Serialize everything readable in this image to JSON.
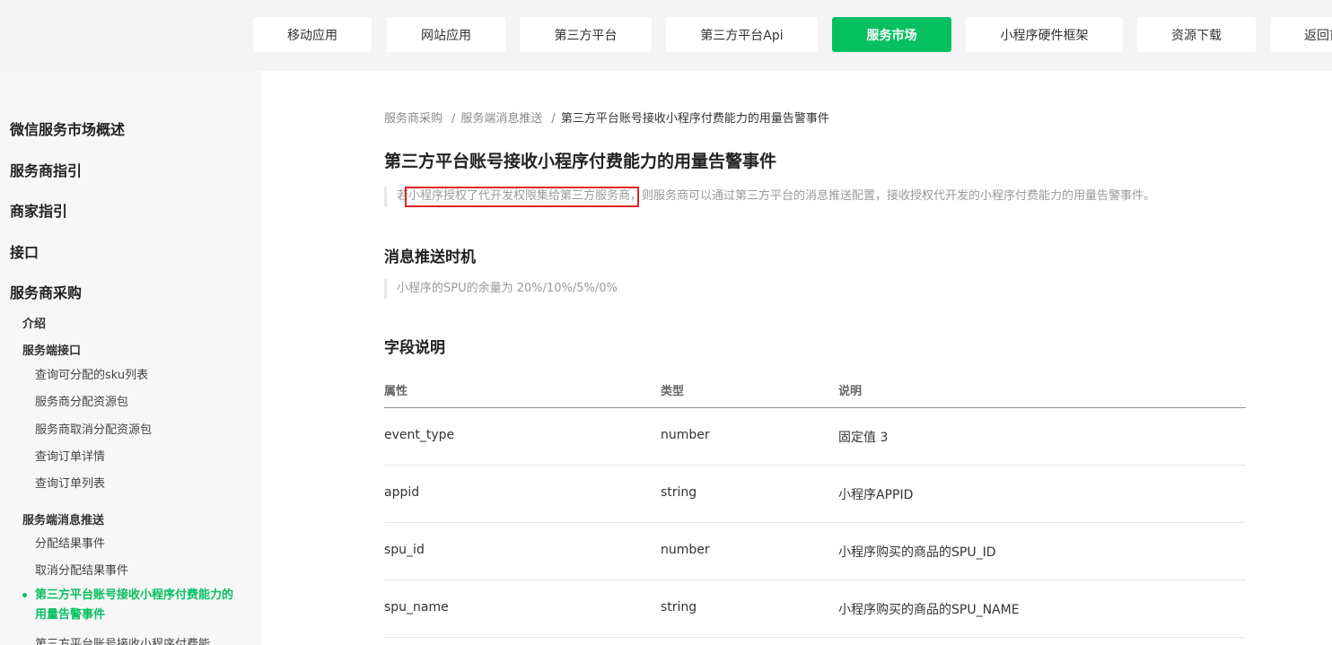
{
  "top_nav": {
    "items": [
      {
        "label": "移动应用"
      },
      {
        "label": "网站应用"
      },
      {
        "label": "第三方平台"
      },
      {
        "label": "第三方平台Api"
      },
      {
        "label": "服务市场",
        "active": true
      },
      {
        "label": "小程序硬件框架"
      },
      {
        "label": "资源下载"
      },
      {
        "label": "返回首"
      }
    ],
    "active_color": "#07c160"
  },
  "sidebar": {
    "level1": [
      {
        "label": "微信服务市场概述"
      },
      {
        "label": "服务商指引"
      },
      {
        "label": "商家指引"
      },
      {
        "label": "接口"
      },
      {
        "label": "服务商采购"
      }
    ],
    "intro_label": "介绍",
    "group_api": {
      "label": "服务端接口",
      "items": [
        {
          "label": "查询可分配的sku列表"
        },
        {
          "label": "服务商分配资源包"
        },
        {
          "label": "服务商取消分配资源包"
        },
        {
          "label": "查询订单详情"
        },
        {
          "label": "查询订单列表"
        }
      ]
    },
    "group_push": {
      "label": "服务端消息推送",
      "items": [
        {
          "label": "分配结果事件"
        },
        {
          "label": "取消分配结果事件"
        }
      ],
      "active_label": "第三方平台账号接收小程序付费能力的用量告警事件",
      "next_label_partial": "第三方平台账号接收小程序付费能"
    }
  },
  "breadcrumb": {
    "items": [
      "服务商采购",
      "服务端消息推送"
    ],
    "separator": "/",
    "current": "第三方平台账号接收小程序付费能力的用量告警事件"
  },
  "page_title": "第三方平台账号接收小程序付费能力的用量告警事件",
  "intro_text": "若小程序授权了代开发权限集给第三方服务商，则服务商可以通过第三方平台的消息推送配置，接收授权代开发的小程序付费能力的用量告警事件。",
  "section_timing": {
    "title": "消息推送时机",
    "text": "小程序的SPU的余量为 20%/10%/5%/0%"
  },
  "section_fields": {
    "title": "字段说明",
    "headers": [
      "属性",
      "类型",
      "说明"
    ],
    "rows": [
      [
        "event_type",
        "number",
        "固定值 3"
      ],
      [
        "appid",
        "string",
        "小程序APPID"
      ],
      [
        "spu_id",
        "number",
        "小程序购买的商品的SPU_ID"
      ],
      [
        "spu_name",
        "string",
        "小程序购买的商品的SPU_NAME"
      ]
    ]
  },
  "annotation_color": "#e02424"
}
